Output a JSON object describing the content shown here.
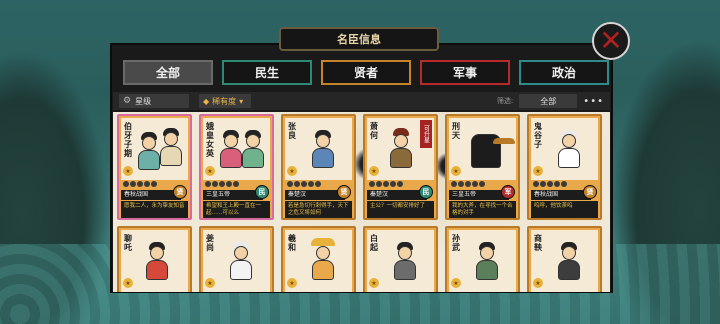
{
  "window_title": "名臣信息",
  "tabs": [
    {
      "label": "全部",
      "key": "all"
    },
    {
      "label": "民生",
      "key": "people"
    },
    {
      "label": "贤者",
      "key": "sage"
    },
    {
      "label": "军事",
      "key": "army"
    },
    {
      "label": "政治",
      "key": "gov"
    }
  ],
  "toolbar": {
    "star_label": "星级",
    "rarity_label": "稀有度",
    "filter_label": "筛选:",
    "filter_value": "全部",
    "more": "•••"
  },
  "cards": [
    {
      "name": "伯牙子期",
      "era": "春秋战国",
      "badge": "贤",
      "badge_type": "sage",
      "quote": "愿我二人，永为挚友知音",
      "border": "pink"
    },
    {
      "name": "娥皇女英",
      "era": "三皇五帝",
      "badge": "民",
      "badge_type": "people",
      "quote": "希望和王上殿一直在一起……可以么",
      "border": "pink"
    },
    {
      "name": "张良",
      "era": "秦楚汉",
      "badge": "贤",
      "badge_type": "sage",
      "quote": "若是急切行刺得手，天下之危又将如何",
      "border": "normal"
    },
    {
      "name": "萧何",
      "era": "秦楚汉",
      "badge": "民",
      "badge_type": "people",
      "quote": "主公？一切都安排好了",
      "border": "normal",
      "tag": "可升星"
    },
    {
      "name": "刑天",
      "era": "三皇五帝",
      "badge": "军",
      "badge_type": "army",
      "quote": "我的大斧，在寻找一个合格的对手",
      "border": "normal"
    },
    {
      "name": "鬼谷子",
      "era": "春秋战国",
      "badge": "贤",
      "badge_type": "sage",
      "quote": "呜呼，他饮茶呜",
      "border": "normal"
    },
    {
      "name": "聊吒",
      "era": "",
      "badge": "",
      "badge_type": "",
      "quote": "",
      "border": "normal"
    },
    {
      "name": "姜尚",
      "era": "",
      "badge": "",
      "badge_type": "",
      "quote": "",
      "border": "normal"
    },
    {
      "name": "羲和",
      "era": "",
      "badge": "",
      "badge_type": "",
      "quote": "",
      "border": "normal"
    },
    {
      "name": "白起",
      "era": "",
      "badge": "",
      "badge_type": "",
      "quote": "",
      "border": "normal"
    },
    {
      "name": "孙武",
      "era": "",
      "badge": "",
      "badge_type": "",
      "quote": "",
      "border": "normal"
    },
    {
      "name": "商鞅",
      "era": "",
      "badge": "",
      "badge_type": "",
      "quote": "",
      "border": "normal"
    }
  ],
  "colors": {
    "accent_gold": "#e9a84a",
    "sage": "#c6842a",
    "people": "#2f8a74",
    "army": "#b52a2a"
  }
}
